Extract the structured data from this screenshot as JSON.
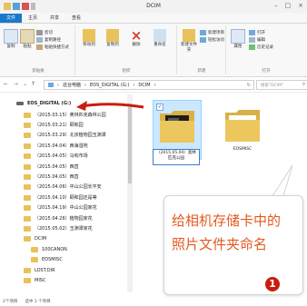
{
  "window": {
    "title": "DCIM"
  },
  "tabs": [
    "文件",
    "主页",
    "共享",
    "查看"
  ],
  "ribbon": {
    "clipboard": {
      "caption": "剪贴板",
      "items": [
        "复制",
        "粘贴",
        "剪切",
        "复制路径",
        "粘贴快捷方式"
      ]
    },
    "organize": {
      "caption": "组织",
      "items": [
        "移动到",
        "复制到",
        "删除",
        "重命名"
      ]
    },
    "new": {
      "caption": "新建",
      "items": [
        "新建文件夹",
        "新建项目",
        "轻松访问"
      ]
    },
    "open": {
      "caption": "打开",
      "items": [
        "属性",
        "打开",
        "编辑",
        "历史记录"
      ]
    }
  },
  "address": {
    "path": [
      "这台电脑",
      "EOS_DIGITAL (G:)",
      "DCIM"
    ],
    "search_placeholder": "搜索\"DCIM\""
  },
  "nav": {
    "drive": "EOS_DIGITAL (G:)",
    "items": [
      "（2015.03.15）奥林匹克森林公园",
      "（2015.03.21）颐和园",
      "（2015.03.29）北京植物园玉渊潭",
      "（2015.04.04）西海湿地",
      "（2015.04.05）马甸市场",
      "（2015.04.05）西直",
      "（2015.04.05）西直",
      "（2015.04.06）中山公园长平安",
      "（2015.04.10）颐和园还是等",
      "（2015.04.19）中山公园家花",
      "（2015.04.26）植物园家花",
      "（2015.05.02）玉渊潭家花"
    ],
    "dcim": "DCIM",
    "sub": [
      "100CANON",
      "EOSMISC"
    ],
    "others": [
      "LOST.DIR",
      "MISC"
    ]
  },
  "files": [
    {
      "name": "（2015.05.04）奥林匹克公园",
      "selected": true,
      "has_photo": true
    },
    {
      "name": "EOSMISC",
      "selected": false,
      "has_photo": false
    }
  ],
  "status": {
    "count": "2个项目",
    "selection": "选中 1 个项目"
  },
  "callout": {
    "line1": "给相机存储卡中的",
    "line2": "照片文件夹命名"
  },
  "badge": "1",
  "colors": {
    "accent": "#1979ca",
    "callout_text": "#e35a20",
    "badge": "#c81d0e",
    "arrow": "#c81d0e",
    "folder": "#e8c25a"
  }
}
